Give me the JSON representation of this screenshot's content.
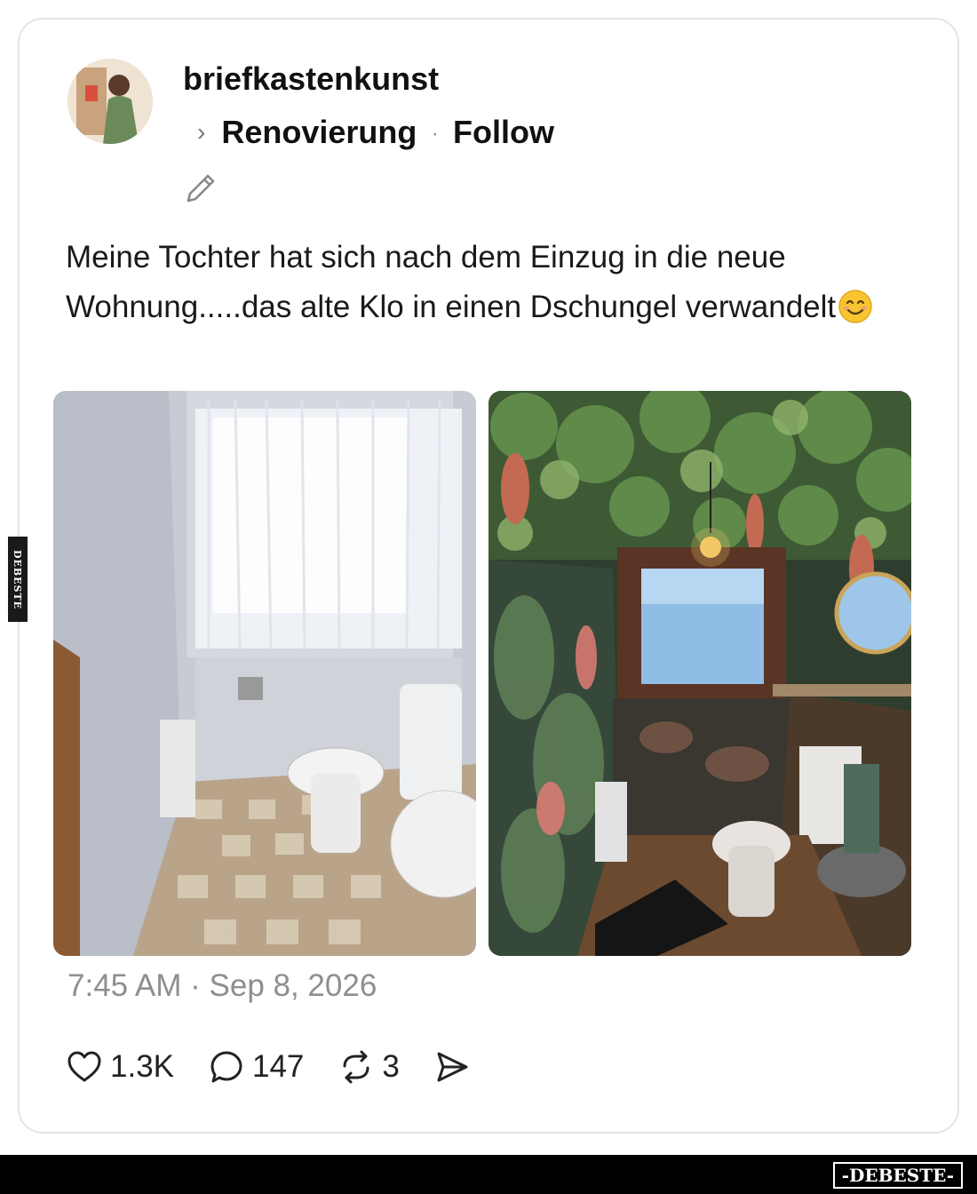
{
  "post": {
    "username": "briefkastenkunst",
    "topic": "Renovierung",
    "separator": "·",
    "follow_label": "Follow",
    "text": "Meine Tochter hat sich nach dem Einzug in die neue Wohnung.....das alte Klo in einen Dschungel verwandelt",
    "emoji": "smiling-face-emoji",
    "timestamp": "7:45 AM · Sep 8, 2026"
  },
  "actions": {
    "likes": "1.3K",
    "comments": "147",
    "reposts": "3"
  },
  "icons": {
    "like": "heart-icon",
    "comment": "comment-bubble-icon",
    "repost": "repost-icon",
    "share": "send-icon",
    "edit": "pencil-icon",
    "topic": "chevron-right-icon"
  },
  "watermark": {
    "side": "DEBESTE",
    "bottom": "-DEBESTE-"
  },
  "colors": {
    "text": "#1a1a1a",
    "muted": "#8e8e93",
    "border": "#e4e4e6"
  }
}
